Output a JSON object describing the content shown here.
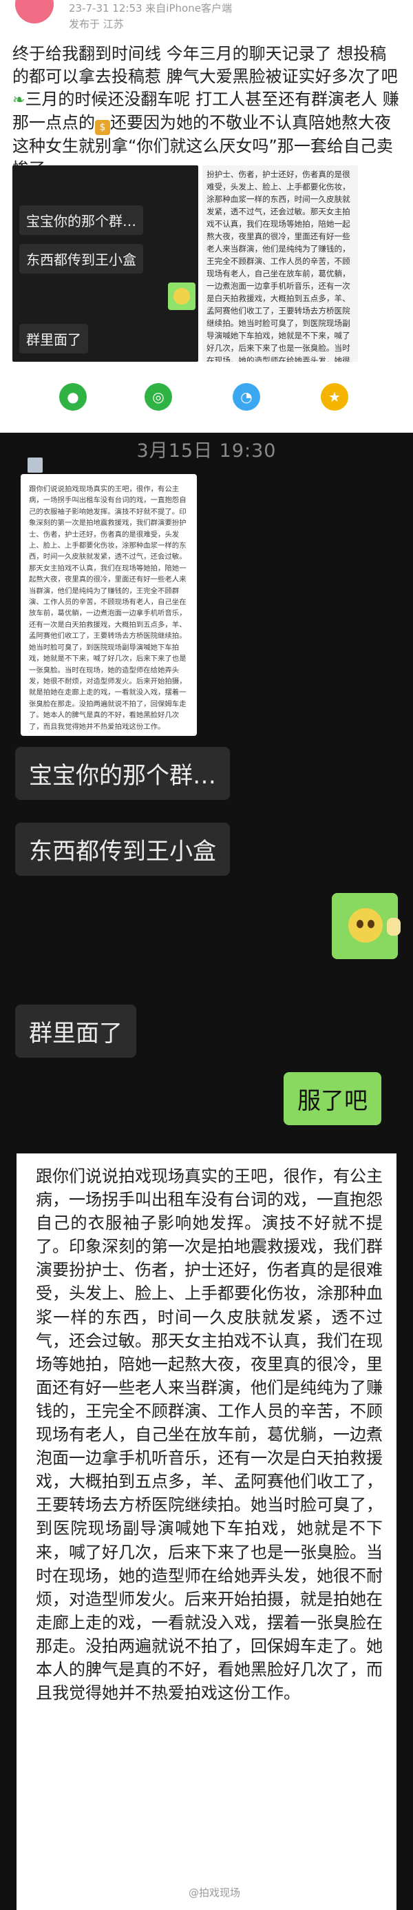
{
  "post": {
    "timestamp_line": "23-7-31 12:53  来自iPhone客户端",
    "location_line": "发布于 江苏",
    "text_part1": "终于给我翻到时间线 今年三月的聊天记录了 想投稿的都可以拿去投稿惹 脾气大爱黑脸被证实好多次了吧",
    "text_part2": "三月的时候还没翻车呢 打工人甚至还有群演老人 赚那一点点的",
    "text_part3": "还要因为她的不敬业不认真陪她熬大夜 这种女生就别拿“你们就这么厌女吗”那一套给自己卖惨了",
    "money_glyph": "$",
    "leaf_glyph": "❧",
    "thumb_bubbles": [
      "宝宝你的那个群…",
      "东西都传到王小盒",
      "群里面了"
    ],
    "thumb2_text": "扮护士、伤者，护士还好，伤者真的是很难受，头发上、脸上、上手都要化伤妆，涂那种血浆一样的东西，时间一久皮肤就发紧，透不过气，还会过敏。那天女主拍戏不认真，我们在现场等她拍，陪她一起熬大夜，夜里真的很冷，里面还有好一些老人来当群演，他们是纯纯为了赚钱的，王完全不顾群演、工作人员的辛苦，不顾现场有老人，自己坐在放车前，葛优躺，一边煮泡面一边拿手机听音乐，还有一次是白天拍救援戏，大概拍到五点多，羊、孟阿赛他们收工了，王要转场去方桥医院继续拍。她当时脸可臭了，到医院现场副导演喊她下车拍戏，她就是不下来，喊了好几次，后来下来了也是一张臭脸。当时在现场，她的造型师在给她弄头发，她很不耐烦，对造型师发火。后来开始拍"
  },
  "chat": {
    "time": "3月15日  19:30",
    "image_text": "跟你们说说拍戏现场真实的王吧，很作，有公主病，一场拐手叫出租车没有台词的戏，一直抱怨自己的衣服袖子影响她发挥。演技不好就不提了。印象深刻的第一次是拍地震救援戏，我们群演要扮护士、伤者，护士还好，伤者真的是很难受，头发上、脸上、上手都要化伤妆，涂那种血浆一样的东西，时间一久皮肤就发紧，透不过气，还会过敏。那天女主拍戏不认真，我们在现场等她拍，陪她一起熬大夜，夜里真的很冷，里面还有好一些老人来当群演，他们是纯纯为了赚钱的，王完全不顾群演、工作人员的辛苦，不顾现场有老人，自己坐在放车前，葛优躺，一边煮泡面一边拿手机听音乐，还有一次是白天拍救援戏，大概拍到五点多，羊、孟阿赛他们收工了，王要转场去方桥医院继续拍。她当时脸可臭了，到医院现场副导演喊她下车拍戏，她就是不下来，喊了好几次，后来下来了也是一张臭脸。当时在现场，她的造型师在给她弄头发，她很不耐烦，对造型师发火。后来开始拍摄，就是拍她在走廊上走的戏，一看就没入戏，摆着一张臭脸在那走。没拍两遍就说不拍了，回保姆车走了。她本人的脾气是真的不好，看她黑脸好几次了，而且我觉得她并不热爱拍戏这份工作。",
    "messages": [
      {
        "text": "宝宝你的那个群…"
      },
      {
        "text": "东西都传到王小盒"
      },
      {
        "text": "群里面了"
      },
      {
        "text": "服了吧"
      }
    ]
  },
  "longtext": {
    "text": "跟你们说说拍戏现场真实的王吧，很作，有公主病，一场拐手叫出租车没有台词的戏，一直抱怨自己的衣服袖子影响她发挥。演技不好就不提了。印象深刻的第一次是拍地震救援戏，我们群演要扮护士、伤者，护士还好，伤者真的是很难受，头发上、脸上、上手都要化伤妆，涂那种血浆一样的东西，时间一久皮肤就发紧，透不过气，还会过敏。那天女主拍戏不认真，我们在现场等她拍，陪她一起熬大夜，夜里真的很冷，里面还有好一些老人来当群演，他们是纯纯为了赚钱的，王完全不顾群演、工作人员的辛苦，不顾现场有老人，自己坐在放车前，葛优躺，一边煮泡面一边拿手机听音乐，还有一次是白天拍救援戏，大概拍到五点多，羊、孟阿赛他们收工了，王要转场去方桥医院继续拍。她当时脸可臭了，到医院现场副导演喊她下车拍戏，她就是不下来，喊了好几次，后来下来了也是一张臭脸。当时在现场，她的造型师在给她弄头发，她很不耐烦，对造型师发火。后来开始拍摄，就是拍她在走廊上走的戏，一看就没入戏，摆着一张臭脸在那走。没拍两遍就说不拍了，回保姆车走了。她本人的脾气是真的不好，看她黑脸好几次了，而且我觉得她并不热爱拍戏这份工作。",
    "watermark": "@拍戏现场"
  },
  "colors": {
    "wechat_green": "#89d961",
    "bubble_dark": "#2c2c2c",
    "chat_bg": "#111111",
    "share_wechat": "#2fb344",
    "share_moments": "#2fb344",
    "share_qq": "#3aa7f0",
    "share_qzone": "#f4b400"
  },
  "icons": [
    "wechat-share-icon",
    "moments-share-icon",
    "qq-share-icon",
    "qzone-share-icon"
  ]
}
